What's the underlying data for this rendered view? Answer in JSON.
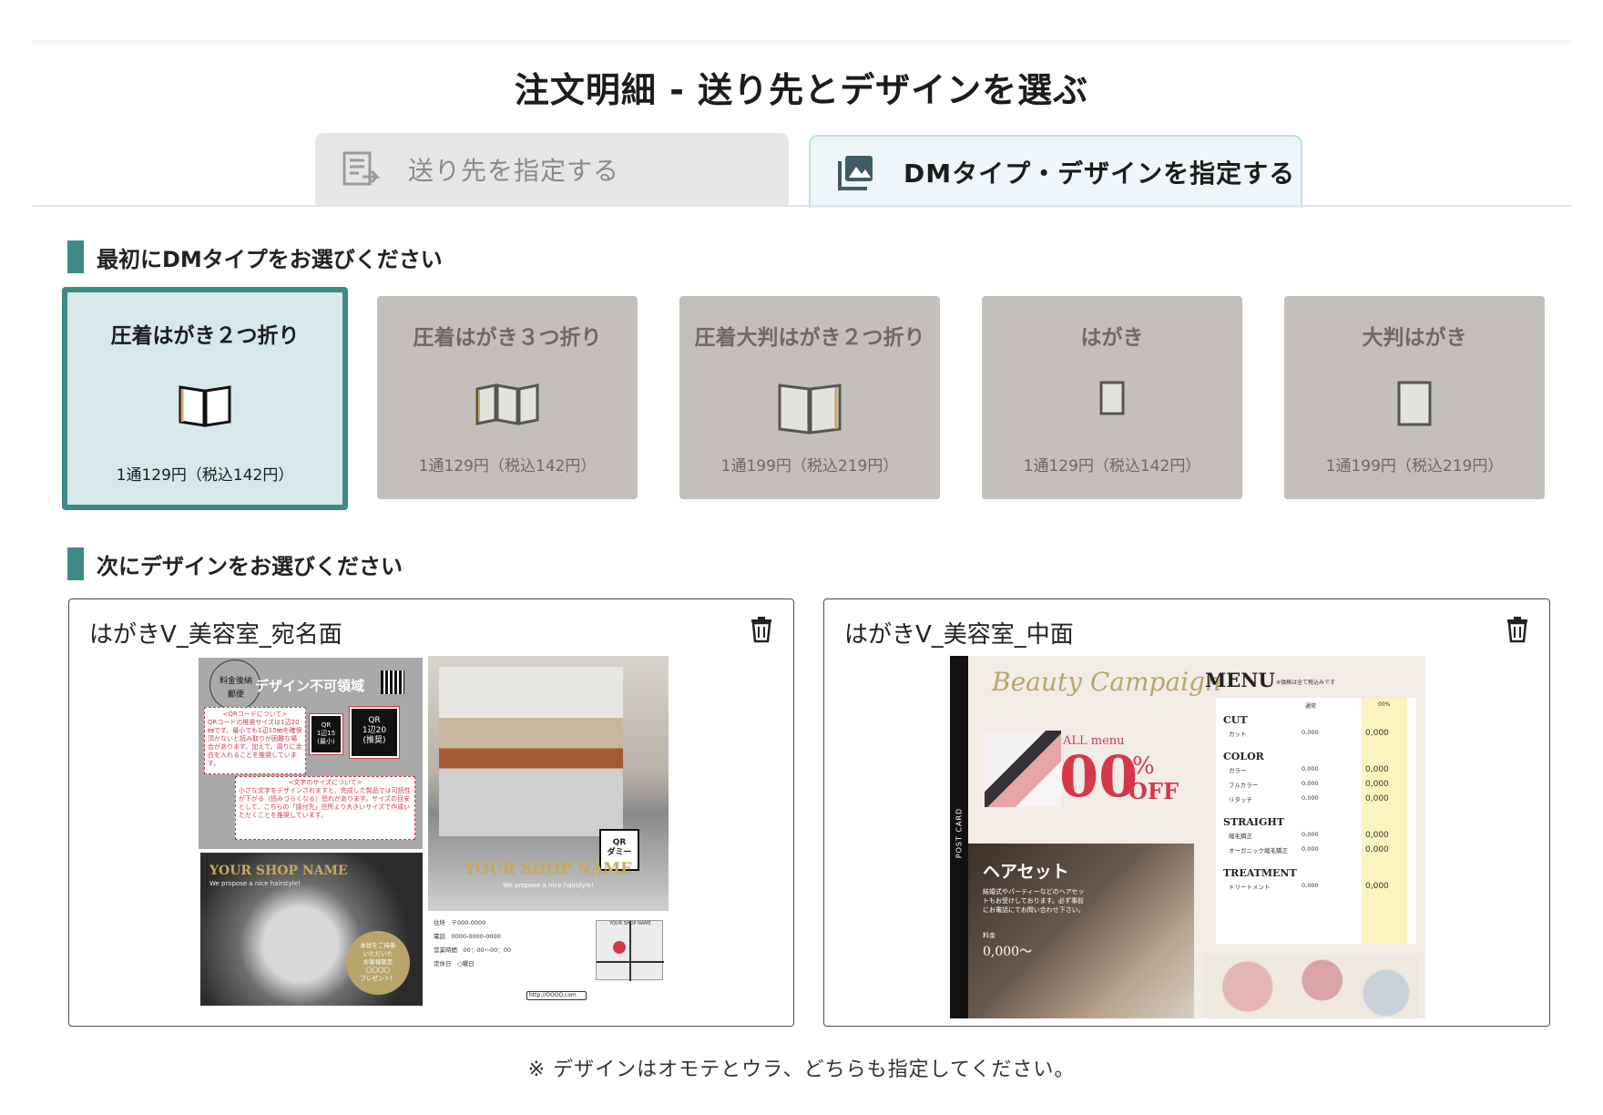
{
  "page_title": "注文明細 - 送り先とデザインを選ぶ",
  "tabs": [
    {
      "label": "送り先を指定する",
      "icon": "address-list-icon",
      "active": false
    },
    {
      "label": "DMタイプ・デザインを指定する",
      "icon": "image-gallery-icon",
      "active": true
    }
  ],
  "section1": {
    "heading": "最初にDMタイプをお選びください"
  },
  "dm_types": [
    {
      "name": "圧着はがき２つ折り",
      "price": "1通129円（税込142円）",
      "selected": true,
      "icon": "open-book-icon"
    },
    {
      "name": "圧着はがき３つ折り",
      "price": "1通129円（税込142円）",
      "selected": false,
      "icon": "trifold-icon"
    },
    {
      "name": "圧着大判はがき２つ折り",
      "price": "1通199円（税込219円）",
      "selected": false,
      "icon": "large-bifold-icon"
    },
    {
      "name": "はがき",
      "price": "1通129円（税込142円）",
      "selected": false,
      "icon": "postcard-icon"
    },
    {
      "name": "大判はがき",
      "price": "1通199円（税込219円）",
      "selected": false,
      "icon": "large-postcard-icon"
    }
  ],
  "section2": {
    "heading": "次にデザインをお選びください"
  },
  "designs": [
    {
      "title": "はがきV_美容室_宛名面",
      "preview": {
        "header": "デザイン不可領域",
        "stamp_lines": [
          "料金後納",
          "郵便"
        ],
        "qr_note_title": "<QRコードについて>",
        "qr_note_body": "QRコードの推奨サイズは1辺20㎜です。最小でも1辺15㎜を確保頂かないと読み取りが困難な場合があります。加えて、周りに余白を入れることを推奨しています。",
        "qr_small": "QR\n1辺15\n(最小)",
        "qr_large": "QR\n1辺20\n(推奨)",
        "text_note_title": "<文字のサイズについて>",
        "text_note_body": "小さな文字をデザインされますと、完成した製品では可読性が下がる（読みづらくなる）恐れがあります。サイズの目安として、こちらの「請付先」住所より大きいサイズで作成いただくことを推奨しています。",
        "shop_name": "YOUR SHOP NAME",
        "tagline": "We propose a nice hairstyle!",
        "badge_lines": [
          "本状をご持参",
          "いただいた",
          "お客様限定",
          "〇〇〇〇",
          "プレゼント！"
        ],
        "qr_dummy": "QR\nダミー",
        "info_rows": [
          "住所　〒000-0000",
          "電話　0000-0000-0000",
          "営業時間　00：00〜00：00",
          "定休日　○曜日"
        ],
        "url": "http://OOOO.com",
        "map_label": "YOUR SHOP NAME"
      }
    },
    {
      "title": "はがきV_美容室_中面",
      "preview": {
        "postcard_label": "POST CARD",
        "campaign_title": "Beauty Campaign",
        "all_menu": "ALL menu",
        "discount": "00",
        "percent": "%",
        "off": "OFF",
        "hair_set": "ヘアセット",
        "hair_set_desc": "結婚式やパーティーなどのヘアセットもお受けしております。必ず事前にお電話にてお問い合わせ下さい。",
        "hair_set_price_label": "料金",
        "hair_set_price": "0,000〜",
        "menu_title": "MENU",
        "menu_note": "※価格は全て税込みです",
        "col_regular": "通常",
        "col_sale": "00%",
        "categories": [
          {
            "name": "CUT",
            "items": [
              {
                "label": "カット",
                "regular": "0,000",
                "sale": "0,000"
              }
            ]
          },
          {
            "name": "COLOR",
            "items": [
              {
                "label": "カラー",
                "regular": "0,000",
                "sale": "0,000"
              },
              {
                "label": "フルカラー",
                "regular": "0,000",
                "sale": "0,000"
              },
              {
                "label": "リタッチ",
                "regular": "0,000",
                "sale": "0,000"
              }
            ]
          },
          {
            "name": "STRAIGHT",
            "items": [
              {
                "label": "縮毛矯正",
                "regular": "0,000",
                "sale": "0,000"
              },
              {
                "label": "オーガニック縮毛矯正",
                "regular": "0,000",
                "sale": "0,000"
              }
            ]
          },
          {
            "name": "TREATMENT",
            "items": [
              {
                "label": "トリートメント",
                "regular": "0,000",
                "sale": "0,000"
              }
            ]
          }
        ]
      }
    }
  ],
  "footnote": "※ デザインはオモテとウラ、どちらも指定してください。",
  "colors": {
    "accent": "#3f8a88",
    "selected_bg": "#d7e8ea",
    "card_bg": "#c3c0bb",
    "discount_red": "#d6384a"
  }
}
